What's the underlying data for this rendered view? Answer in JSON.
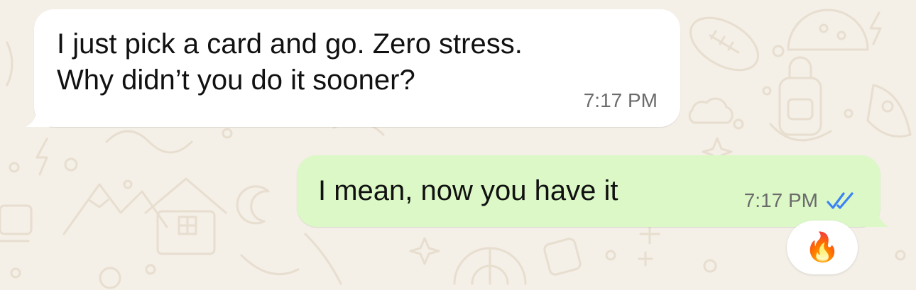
{
  "chat": {
    "messages": [
      {
        "direction": "incoming",
        "text": "I just pick a card and go. Zero stress.\nWhy didn’t you do it sooner?",
        "time": "7:17 PM"
      },
      {
        "direction": "outgoing",
        "text": "I mean, now you have it",
        "time": "7:17 PM",
        "status": "read",
        "status_icon": "double-check-icon",
        "reaction": "🔥"
      }
    ]
  },
  "colors": {
    "wallpaper": "#f4efe7",
    "wallpaper_doodle": "#e6dccd",
    "incoming_bubble": "#ffffff",
    "outgoing_bubble": "#dbf8c6",
    "read_ticks": "#3b82f6",
    "timestamp": "#6b6b6b"
  }
}
